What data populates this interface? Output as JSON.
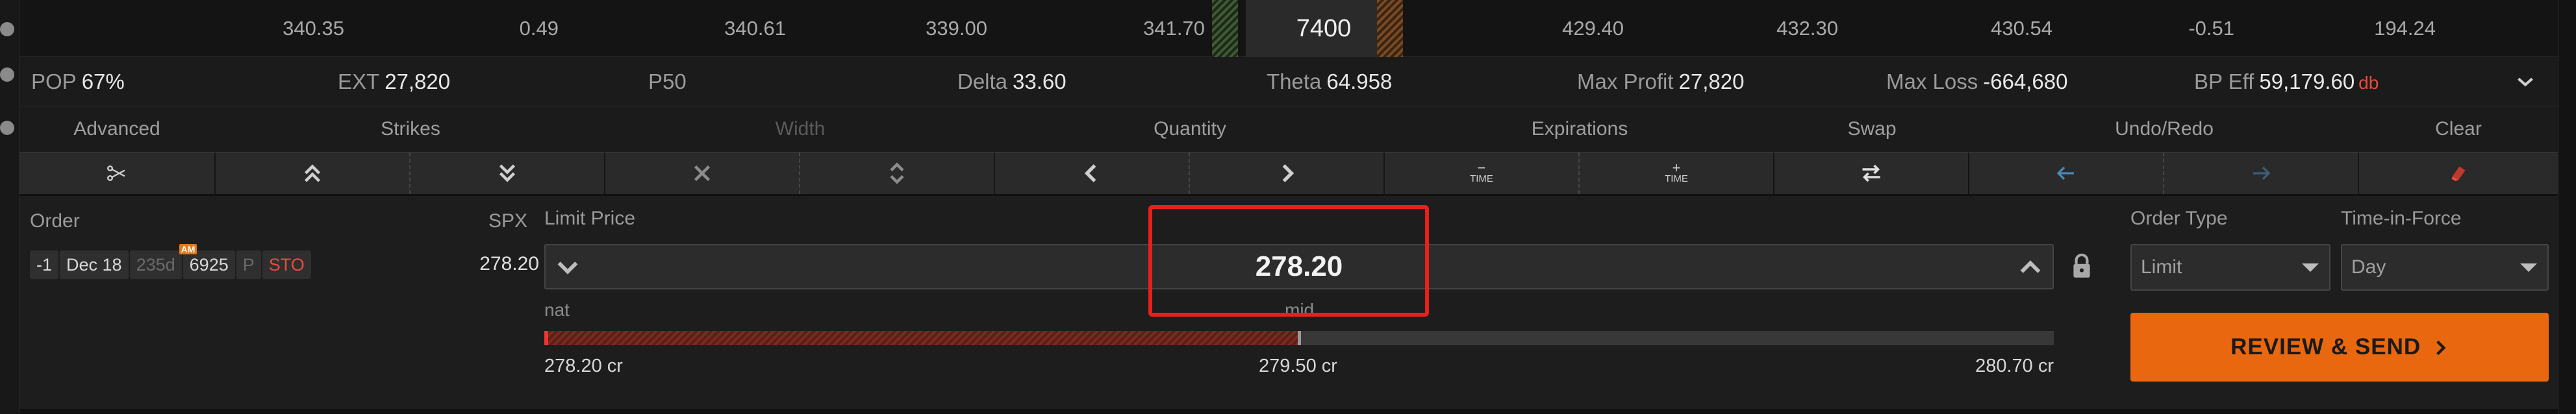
{
  "ladder": {
    "values": [
      "340.35",
      "0.49",
      "340.61",
      "339.00",
      "341.70",
      "429.40",
      "432.30",
      "430.54",
      "-0.51",
      "194.24"
    ],
    "strike": "7400"
  },
  "stats": {
    "pop_label": "POP",
    "pop_value": "67%",
    "ext_label": "EXT",
    "ext_value": "27,820",
    "p50_label": "P50",
    "p50_value": "",
    "delta_label": "Delta",
    "delta_value": "33.60",
    "theta_label": "Theta",
    "theta_value": "64.958",
    "maxprofit_label": "Max Profit",
    "maxprofit_value": "27,820",
    "maxloss_label": "Max Loss",
    "maxloss_value": "-664,680",
    "bpeff_label": "BP Eff",
    "bpeff_value": "59,179.60",
    "bpeff_unit": "db"
  },
  "actions": {
    "advanced": "Advanced",
    "strikes": "Strikes",
    "width": "Width",
    "quantity": "Quantity",
    "expirations": "Expirations",
    "swap": "Swap",
    "undo_redo": "Undo/Redo",
    "clear": "Clear",
    "time_word": "TIME",
    "minus": "−",
    "plus": "+"
  },
  "order": {
    "order_label": "Order",
    "spx_label": "SPX",
    "leg": {
      "qty": "-1",
      "expiry": "Dec 18",
      "dte": "235d",
      "am_badge": "AM",
      "strike": "6925",
      "type": "P",
      "action": "STO"
    },
    "spx_value": "278.20",
    "limit_price_label": "Limit Price",
    "limit_price": "278.20",
    "nat_label": "nat",
    "mid_label": "mid",
    "low_price": "278.20 cr",
    "mid_price": "279.50 cr",
    "high_price": "280.70 cr",
    "fill_fraction": 0.5,
    "order_type_label": "Order Type",
    "order_type_value": "Limit",
    "tif_label": "Time-in-Force",
    "tif_value": "Day",
    "send_label": "REVIEW & SEND"
  },
  "colors": {
    "accent_orange": "#e8670f",
    "loss_red": "#e74c3c",
    "highlight_red": "#e8201c"
  }
}
